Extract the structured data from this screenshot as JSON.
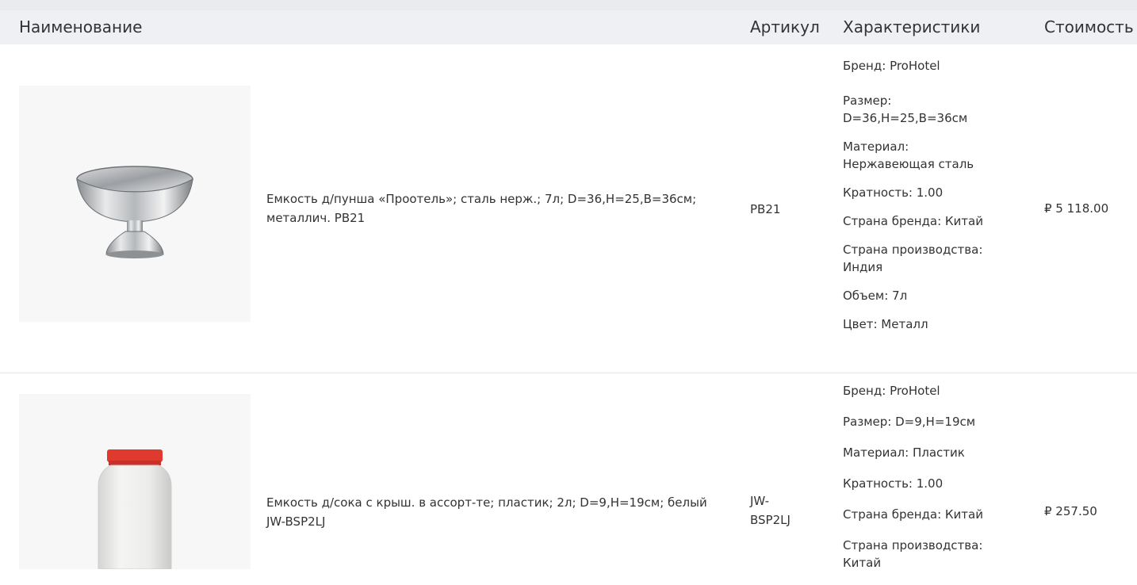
{
  "header": {
    "name": "Наименование",
    "sku": "Артикул",
    "specs": "Характеристики",
    "price": "Стоимость"
  },
  "products": [
    {
      "image_icon": "punch-bowl-icon",
      "name": "Емкость д/пунша «Проотель»; сталь нерж.; 7л; D=36,H=25,B=36см; металлич. PB21",
      "sku": "PB21",
      "price": "₽ 5 118.00",
      "specs": [
        {
          "label": "Бренд:",
          "value": "ProHotel"
        },
        {
          "label": "Размер:",
          "value": "D=36,H=25,B=36см"
        },
        {
          "label": "Материал:",
          "value": "Нержавеющая сталь"
        },
        {
          "label": "Кратность:",
          "value": "1.00"
        },
        {
          "label": "Страна бренда:",
          "value": "Китай"
        },
        {
          "label": "Страна производства:",
          "value": "Индия"
        },
        {
          "label": "Объем:",
          "value": "7л"
        },
        {
          "label": "Цвет:",
          "value": "Металл"
        }
      ]
    },
    {
      "image_icon": "juice-container-icon",
      "name": "Емкость д/сока с крыш. в ассорт-те; пластик; 2л; D=9,H=19см; белый JW-BSP2LJ",
      "sku": "JW-BSP2LJ",
      "price": "₽ 257.50",
      "specs": [
        {
          "label": "Бренд:",
          "value": "ProHotel"
        },
        {
          "label": "Размер:",
          "value": "D=9,H=19см"
        },
        {
          "label": "Материал:",
          "value": "Пластик"
        },
        {
          "label": "Кратность:",
          "value": "1.00"
        },
        {
          "label": "Страна бренда:",
          "value": "Китай"
        },
        {
          "label": "Страна производства:",
          "value": "Китай"
        }
      ]
    }
  ]
}
